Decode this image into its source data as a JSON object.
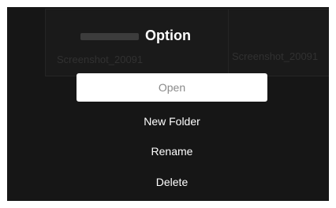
{
  "dialog": {
    "title": "Option",
    "options": [
      {
        "label": "Open",
        "selected": true
      },
      {
        "label": "New Folder",
        "selected": false
      },
      {
        "label": "Rename",
        "selected": false
      },
      {
        "label": "Delete",
        "selected": false
      }
    ]
  },
  "background": {
    "files": [
      {
        "name": "Screenshot_20091"
      },
      {
        "name": "Screenshot_20091"
      }
    ]
  },
  "colors": {
    "backdrop": "#1c1c1c",
    "selected_bg": "#ffffff",
    "selected_text": "#8a8a8a",
    "text": "#ffffff"
  }
}
